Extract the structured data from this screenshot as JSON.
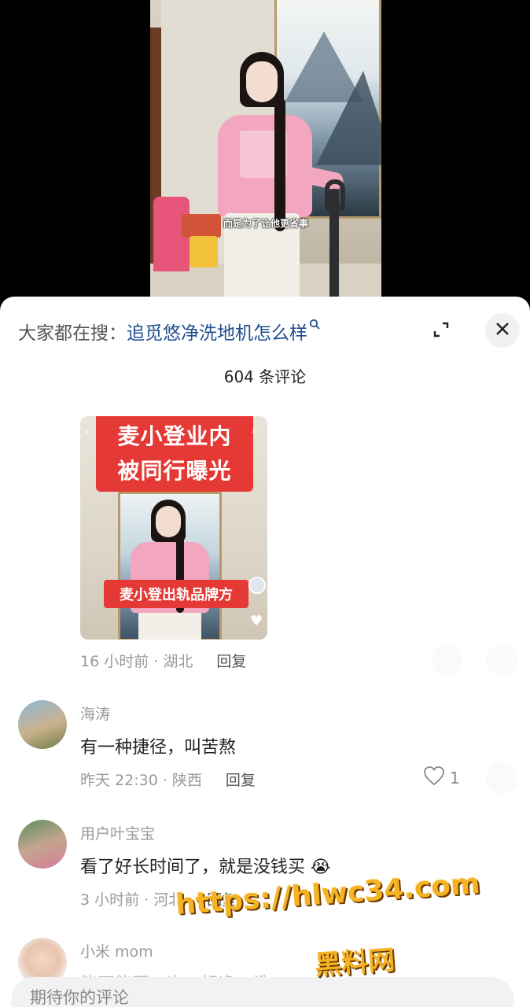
{
  "video": {
    "subtitle": "而是为了让他更省事"
  },
  "sheet": {
    "search_prefix": "大家都在搜：",
    "search_term": "追觅悠净洗地机怎么样",
    "comment_count": "604 条评论"
  },
  "comments": [
    {
      "image": {
        "banner_line1": "麦小登业内",
        "banner_line2": "被同行曝光",
        "tag": "麦小登出轨品牌方"
      },
      "time": "16 小时前 · 湖北",
      "reply_label": "回复"
    },
    {
      "username": "海涛",
      "text": "有一种捷径，叫苦熬",
      "time": "昨天 22:30 · 陕西",
      "reply_label": "回复",
      "likes": "1"
    },
    {
      "username": "用户叶宝宝",
      "text": "看了好长时间了，就是没钱买 😭",
      "time": "3 小时前 · 河北",
      "reply_label": "回复"
    },
    {
      "username": "小米 mom",
      "text": "能不能再一次一轻净一洗"
    }
  ],
  "input": {
    "placeholder": "期待你的评论"
  },
  "watermark": {
    "url": "https://hlwc34.com",
    "name": "黑料网"
  },
  "colors": {
    "search_term": "#1f4f8f",
    "banner_red": "#e53935",
    "watermark": "#f5b324"
  }
}
